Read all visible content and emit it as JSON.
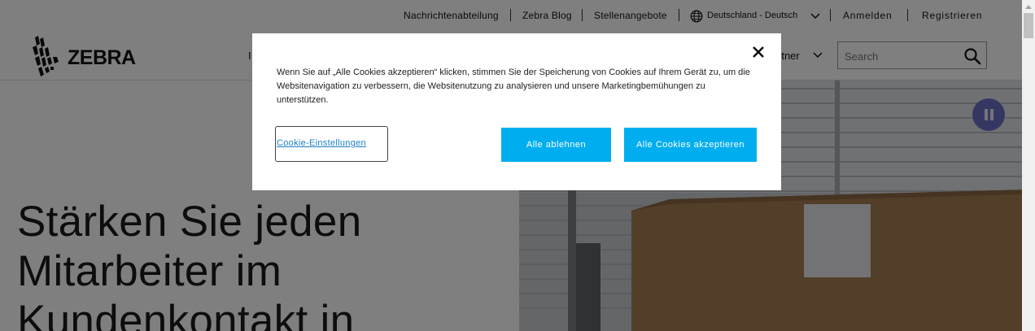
{
  "utility_nav": {
    "newsroom": "Nachrichtenabteilung",
    "blog": "Zebra Blog",
    "careers": "Stellenangebote",
    "locale": "Deutschland - Deutsch",
    "login": "Anmelden",
    "register": "Registrieren"
  },
  "header": {
    "logo_text": "ZEBRA",
    "nav_left_partial": "I",
    "nav_partner_partial": "rtner",
    "search_placeholder": "Search"
  },
  "hero": {
    "title_lines": [
      "Stärken Sie jeden",
      "Mitarbeiter im",
      "Kundenkontakt in"
    ]
  },
  "cookie_dialog": {
    "text": "Wenn Sie auf „Alle Cookies akzeptieren“ klicken, stimmen Sie der Speicherung von Cookies auf Ihrem Gerät zu, um die Websitenavigation zu verbessern, die Websitenutzung zu analysieren und unsere Marketingbemühungen zu unterstützen.",
    "settings_label": "Cookie-Einstellungen",
    "reject_label": "Alle ablehnen",
    "accept_label": "Alle Cookies akzeptieren"
  },
  "colors": {
    "accent": "#00aeef",
    "overlay": "rgba(0,0,0,0.5)",
    "pause_button": "#6b6fc7"
  },
  "icons": {
    "globe": "globe-icon",
    "chevron": "chevron-down-icon",
    "search": "search-icon",
    "close": "close-icon",
    "pause": "pause-icon"
  }
}
